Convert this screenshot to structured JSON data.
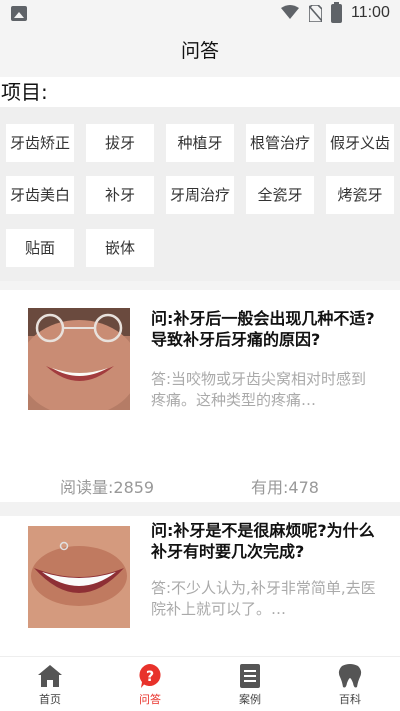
{
  "statusbar": {
    "time": "11:00"
  },
  "header": {
    "title": "问答"
  },
  "category": {
    "label": "项目:",
    "tags": [
      "牙齿矫正",
      "拔牙",
      "种植牙",
      "根管治疗",
      "假牙义齿",
      "牙齿美白",
      "补牙",
      "牙周治疗",
      "全瓷牙",
      "烤瓷牙",
      "贴面",
      "嵌体"
    ]
  },
  "articles": [
    {
      "question": "问:补牙后一般会出现几种不适?导致补牙后牙痛的原因?",
      "answer": "答:当咬物或牙齿尖窝相对时感到疼痛。这种类型的疼痛…",
      "reads": "阅读量:2859",
      "useful": "有用:478"
    },
    {
      "question": "问:补牙是不是很麻烦呢?为什么补牙有时要几次完成?",
      "answer": "答:不少人认为,补牙非常简单,去医院补上就可以了。…"
    }
  ],
  "tabbar": {
    "items": [
      {
        "label": "首页",
        "icon": "home-icon"
      },
      {
        "label": "问答",
        "icon": "question-icon"
      },
      {
        "label": "案例",
        "icon": "document-icon"
      },
      {
        "label": "百科",
        "icon": "tooth-icon"
      }
    ],
    "active_color": "#e8322b",
    "inactive_color": "#555555"
  }
}
